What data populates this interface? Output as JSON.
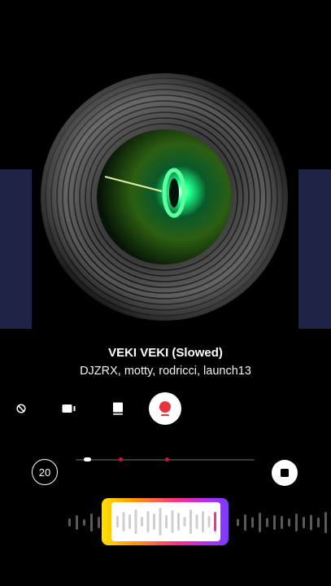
{
  "track": {
    "title": "VEKI VEKI (Slowed)",
    "artists": "DJZRX, motty, rodricci, launch13"
  },
  "toolbar": {
    "icons": [
      "no-effect-icon",
      "video-camera-icon",
      "sticker-icon",
      "record-icon"
    ]
  },
  "timer": {
    "label": "20"
  },
  "timeline": {
    "position": 0.06,
    "markers": [
      0.25,
      0.51
    ]
  },
  "colors": {
    "background": "#000000",
    "side_card": "#1d2446",
    "record_red": "#e8343c",
    "marker_red": "#d1123b",
    "glow_green": "#1bff8a"
  }
}
